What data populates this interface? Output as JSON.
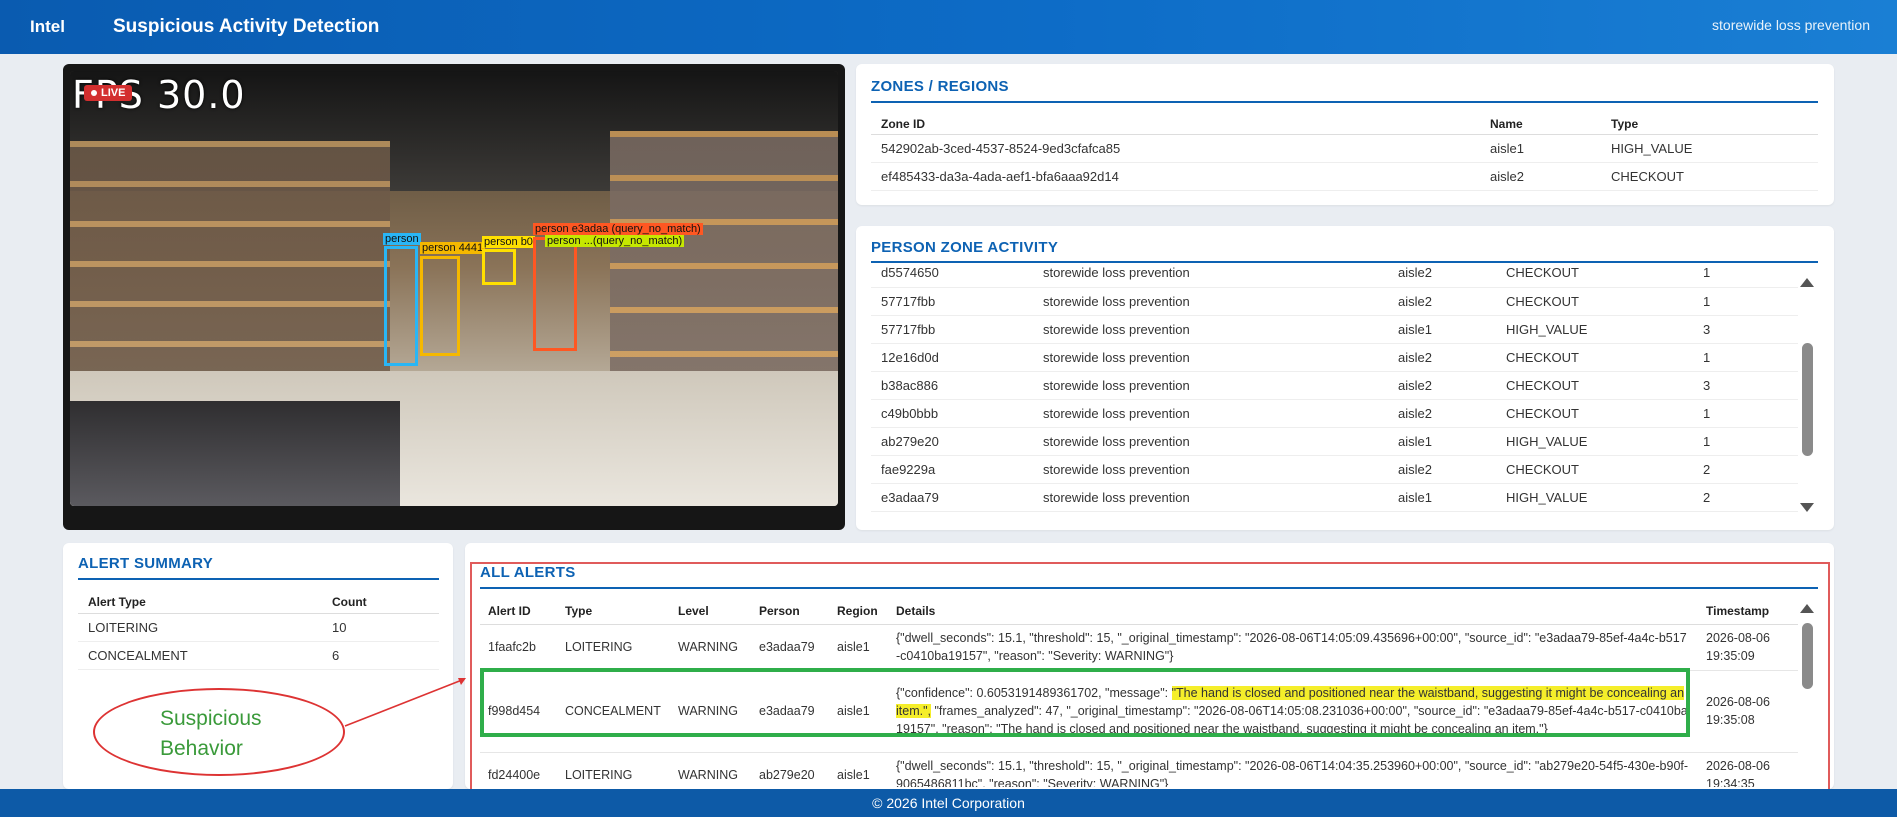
{
  "header": {
    "brand": "Intel",
    "title": "Suspicious Activity Detection",
    "subtitle": "storewide loss prevention"
  },
  "video": {
    "fps_text": "FPS 30.0",
    "live_label": "LIVE",
    "detections": [
      {
        "label": "person",
        "color": "#29b6f6"
      },
      {
        "label": "person 4441",
        "color": "#f5b800"
      },
      {
        "label": "person b0",
        "color": "#ffe000"
      },
      {
        "label": "person e3adaa (query_no_match)",
        "color": "#ff5722"
      },
      {
        "label": "person ...(query_no_match)",
        "color": "#c6e800"
      }
    ]
  },
  "zones": {
    "title": "ZONES / REGIONS",
    "columns": [
      "Zone ID",
      "Name",
      "Type"
    ],
    "rows": [
      [
        "542902ab-3ced-4537-8524-9ed3cfafca85",
        "aisle1",
        "HIGH_VALUE"
      ],
      [
        "ef485433-da3a-4ada-aef1-bfa6aaa92d14",
        "aisle2",
        "CHECKOUT"
      ]
    ]
  },
  "activity": {
    "title": "PERSON ZONE ACTIVITY",
    "rows": [
      [
        "d5574650",
        "storewide loss prevention",
        "aisle2",
        "CHECKOUT",
        "1"
      ],
      [
        "57717fbb",
        "storewide loss prevention",
        "aisle2",
        "CHECKOUT",
        "1"
      ],
      [
        "57717fbb",
        "storewide loss prevention",
        "aisle1",
        "HIGH_VALUE",
        "3"
      ],
      [
        "12e16d0d",
        "storewide loss prevention",
        "aisle2",
        "CHECKOUT",
        "1"
      ],
      [
        "b38ac886",
        "storewide loss prevention",
        "aisle2",
        "CHECKOUT",
        "3"
      ],
      [
        "c49b0bbb",
        "storewide loss prevention",
        "aisle2",
        "CHECKOUT",
        "1"
      ],
      [
        "ab279e20",
        "storewide loss prevention",
        "aisle1",
        "HIGH_VALUE",
        "1"
      ],
      [
        "fae9229a",
        "storewide loss prevention",
        "aisle2",
        "CHECKOUT",
        "2"
      ],
      [
        "e3adaa79",
        "storewide loss prevention",
        "aisle1",
        "HIGH_VALUE",
        "2"
      ]
    ]
  },
  "summary": {
    "title": "ALERT SUMMARY",
    "columns": [
      "Alert Type",
      "Count"
    ],
    "rows": [
      [
        "LOITERING",
        "10"
      ],
      [
        "CONCEALMENT",
        "6"
      ]
    ]
  },
  "alerts": {
    "title": "ALL ALERTS",
    "columns": [
      "Alert ID",
      "Type",
      "Level",
      "Person",
      "Region",
      "Details",
      "Timestamp"
    ],
    "rows": [
      {
        "id": "1faafc2b",
        "type": "LOITERING",
        "level": "WARNING",
        "person": "e3adaa79",
        "region": "aisle1",
        "details": "{\"dwell_seconds\": 15.1, \"threshold\": 15, \"_original_timestamp\": \"2026-08-06T14:05:09.435696+00:00\", \"source_id\": \"e3adaa79-85ef-4a4c-b517-c0410ba19157\", \"reason\": \"Severity: WARNING\"}",
        "timestamp": "2026-08-06 19:35:09"
      },
      {
        "id": "f998d454",
        "type": "CONCEALMENT",
        "level": "WARNING",
        "person": "e3adaa79",
        "region": "aisle1",
        "details_pre": "{\"confidence\": 0.6053191489361702, \"message\": ",
        "details_hl": "\"The hand is closed and positioned near the waistband, suggesting it might be concealing an item.\",",
        "details_post": " \"frames_analyzed\": 47, \"_original_timestamp\": \"2026-08-06T14:05:08.231036+00:00\", \"source_id\": \"e3adaa79-85ef-4a4c-b517-c0410ba19157\", \"reason\": \"The hand is closed and positioned near the waistband, suggesting it might be concealing an item.\"}",
        "timestamp": "2026-08-06 19:35:08"
      },
      {
        "id": "fd24400e",
        "type": "LOITERING",
        "level": "WARNING",
        "person": "ab279e20",
        "region": "aisle1",
        "details": "{\"dwell_seconds\": 15.1, \"threshold\": 15, \"_original_timestamp\": \"2026-08-06T14:04:35.253960+00:00\", \"source_id\": \"ab279e20-54f5-430e-b90f-9065486811bc\", \"reason\": \"Severity: WARNING\"}",
        "timestamp": "2026-08-06 19:34:35"
      }
    ]
  },
  "annotation": {
    "callout_line1": "Suspicious",
    "callout_line2": "Behavior"
  },
  "footer": {
    "text": "© 2026 Intel Corporation"
  }
}
